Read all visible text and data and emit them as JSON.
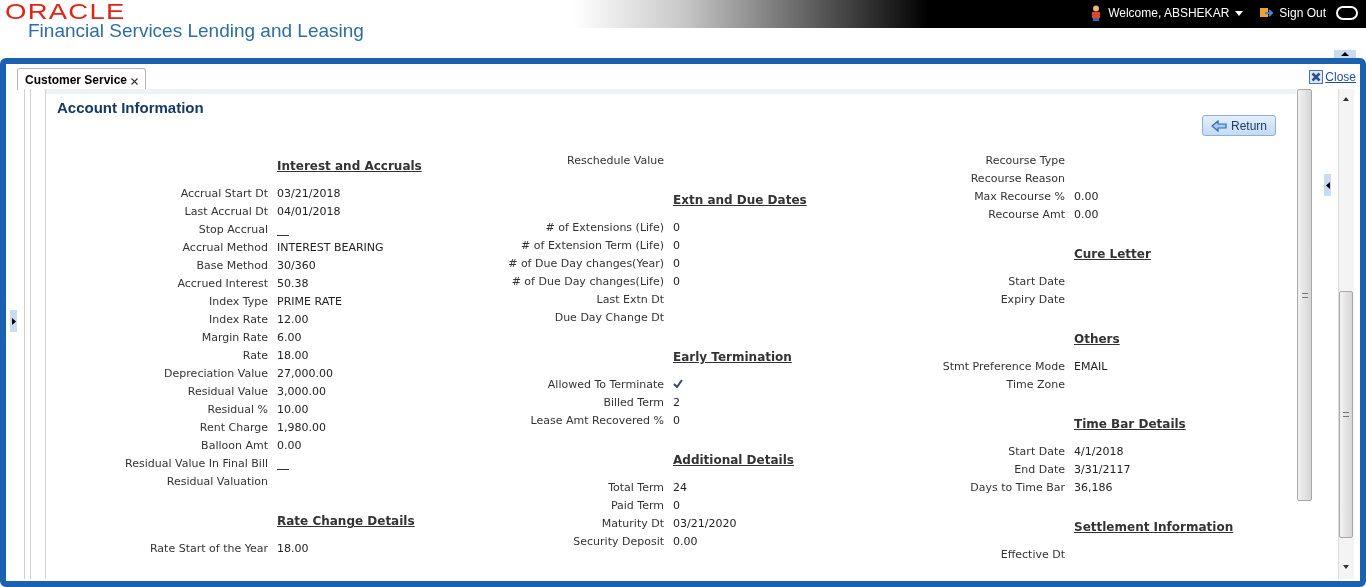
{
  "header": {
    "logo": "ORACLE",
    "product": "Financial Services Lending and Leasing",
    "welcome": "Welcome, ABSHEKAR",
    "sign_out": "Sign Out"
  },
  "tabs": [
    {
      "label": "Customer Service",
      "selected": true
    }
  ],
  "close": "Close",
  "page_title": "Account Information",
  "return_button": "Return",
  "columns": [
    [
      {
        "kind": "heading",
        "text": "Interest and Accruals"
      },
      {
        "kind": "field",
        "label": "Accrual Start Dt",
        "value": "03/21/2018"
      },
      {
        "kind": "field",
        "label": "Last Accrual Dt",
        "value": "04/01/2018"
      },
      {
        "kind": "check",
        "label": "Stop Accrual",
        "checked": false
      },
      {
        "kind": "field",
        "label": "Accrual Method",
        "value": "INTEREST BEARING"
      },
      {
        "kind": "field",
        "label": "Base Method",
        "value": "30/360"
      },
      {
        "kind": "field",
        "label": "Accrued Interest",
        "value": "50.38"
      },
      {
        "kind": "field",
        "label": "Index Type",
        "value": "PRIME RATE"
      },
      {
        "kind": "field",
        "label": "Index Rate",
        "value": "12.00"
      },
      {
        "kind": "field",
        "label": "Margin Rate",
        "value": "6.00"
      },
      {
        "kind": "field",
        "label": "Rate",
        "value": "18.00"
      },
      {
        "kind": "field",
        "label": "Depreciation Value",
        "value": "27,000.00"
      },
      {
        "kind": "field",
        "label": "Residual Value",
        "value": "3,000.00"
      },
      {
        "kind": "field",
        "label": "Residual %",
        "value": "10.00"
      },
      {
        "kind": "field",
        "label": "Rent Charge",
        "value": "1,980.00"
      },
      {
        "kind": "field",
        "label": "Balloon Amt",
        "value": "0.00"
      },
      {
        "kind": "check",
        "label": "Residual Value In Final Bill",
        "checked": false
      },
      {
        "kind": "field",
        "label": "Residual Valuation"
      },
      {
        "kind": "heading",
        "text": "Rate Change Details"
      },
      {
        "kind": "field",
        "label": "Rate Start of the Year",
        "value": "18.00"
      }
    ],
    [
      {
        "kind": "field",
        "label": "Reschedule Value"
      },
      {
        "kind": "heading",
        "text": "Extn and Due Dates"
      },
      {
        "kind": "field",
        "label": "# of Extensions (Life)",
        "value": "0"
      },
      {
        "kind": "field",
        "label": "# of Extension Term (Life)",
        "value": "0"
      },
      {
        "kind": "field",
        "label": "# of Due Day changes(Year)",
        "value": "0"
      },
      {
        "kind": "field",
        "label": "# of Due Day changes(Life)",
        "value": "0"
      },
      {
        "kind": "field",
        "label": "Last Extn Dt"
      },
      {
        "kind": "field",
        "label": "Due Day Change Dt"
      },
      {
        "kind": "heading",
        "text": "Early Termination"
      },
      {
        "kind": "check",
        "label": "Allowed To Terminate",
        "checked": true
      },
      {
        "kind": "field",
        "label": "Billed Term",
        "value": "2"
      },
      {
        "kind": "field",
        "label": "Lease Amt Recovered %",
        "value": "0"
      },
      {
        "kind": "heading",
        "text": "Additional Details"
      },
      {
        "kind": "field",
        "label": "Total Term",
        "value": "24"
      },
      {
        "kind": "field",
        "label": "Paid Term",
        "value": "0"
      },
      {
        "kind": "field",
        "label": "Maturity Dt",
        "value": "03/21/2020"
      },
      {
        "kind": "field",
        "label": "Security Deposit",
        "value": "0.00"
      }
    ],
    [
      {
        "kind": "field",
        "label": "Recourse Type"
      },
      {
        "kind": "field",
        "label": "Recourse Reason"
      },
      {
        "kind": "field",
        "label": "Max Recourse %",
        "value": "0.00"
      },
      {
        "kind": "field",
        "label": "Recourse Amt",
        "value": "0.00"
      },
      {
        "kind": "heading",
        "text": "Cure Letter"
      },
      {
        "kind": "field",
        "label": "Start Date"
      },
      {
        "kind": "field",
        "label": "Expiry Date"
      },
      {
        "kind": "heading",
        "text": "Others"
      },
      {
        "kind": "field",
        "label": "Stmt Preference Mode",
        "value": "EMAIL"
      },
      {
        "kind": "field",
        "label": "Time Zone"
      },
      {
        "kind": "heading",
        "text": "Time Bar Details"
      },
      {
        "kind": "field",
        "label": "Start Date",
        "value": "4/1/2018"
      },
      {
        "kind": "field",
        "label": "End Date",
        "value": "3/31/2117"
      },
      {
        "kind": "field",
        "label": "Days to Time Bar",
        "value": "36,186"
      },
      {
        "kind": "heading",
        "text": "Settlement Information"
      },
      {
        "kind": "field",
        "label": "Effective Dt"
      }
    ]
  ]
}
